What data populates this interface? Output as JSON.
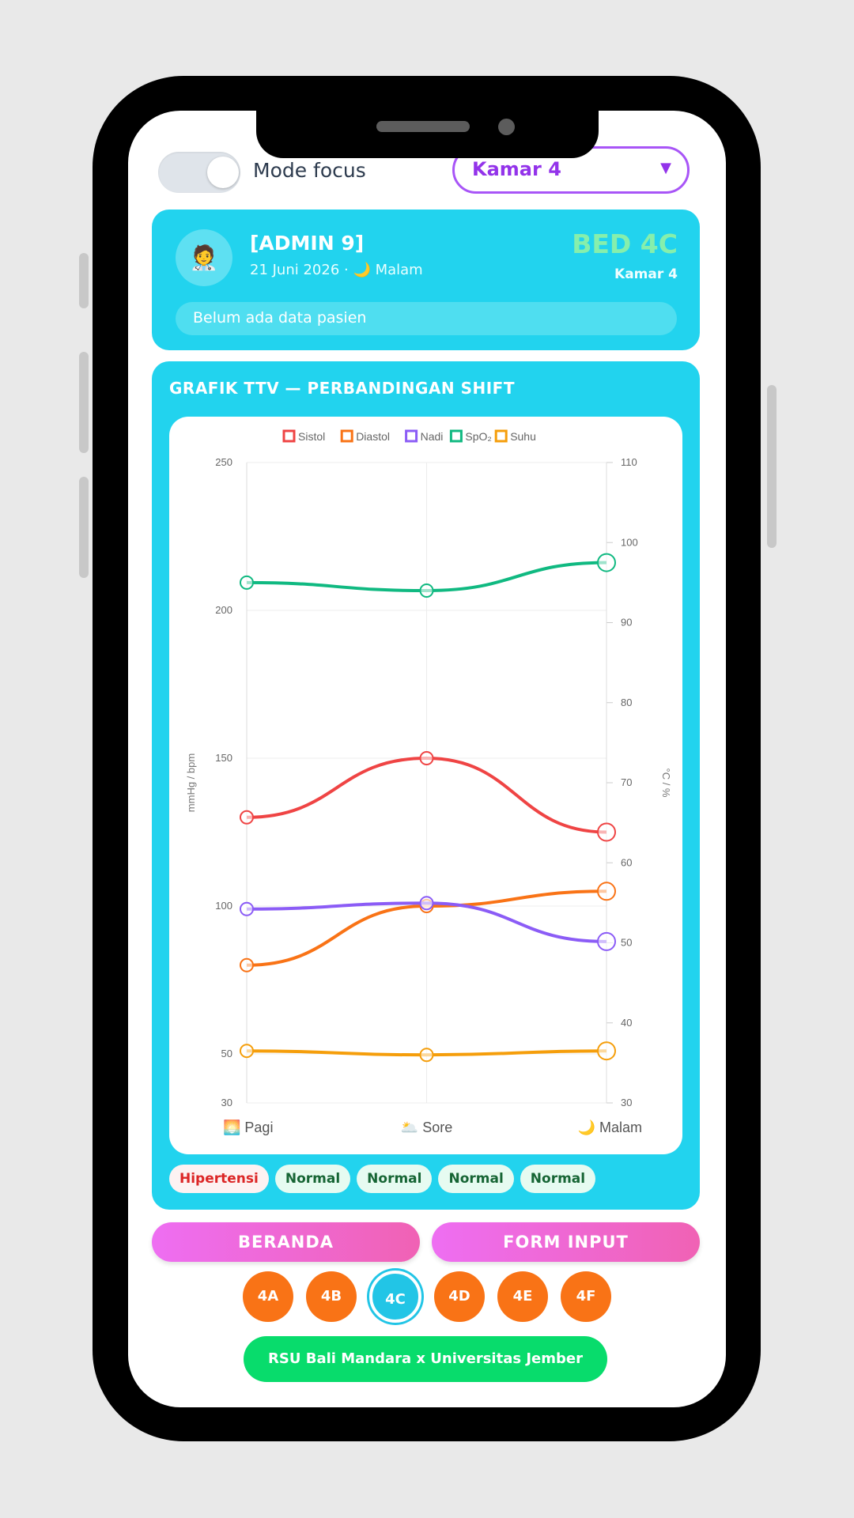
{
  "topbar": {
    "mode_label": "Mode focus",
    "mode_enabled": true,
    "room_select_value": "Kamar 4"
  },
  "patient_card": {
    "avatar_emoji": "🧑‍⚕️",
    "name": "[ADMIN 9]",
    "date_shift": "21 Juni 2026 · 🌙 Malam",
    "bed_title": "BED 4C",
    "room": "Kamar 4",
    "empty_text": "Belum ada data pasien"
  },
  "chart_section": {
    "title": "GRAFIK TTV — PERBANDINGAN SHIFT"
  },
  "chart_data": {
    "type": "line",
    "x": [
      "🌅 Pagi",
      "🌥️ Sore",
      "🌙 Malam"
    ],
    "series": [
      {
        "name": "Sistol",
        "axis": "left",
        "color": "#ef4444",
        "values": [
          130,
          150,
          125
        ]
      },
      {
        "name": "Diastol",
        "axis": "left",
        "color": "#f97316",
        "values": [
          80,
          100,
          105
        ]
      },
      {
        "name": "Nadi",
        "axis": "left",
        "color": "#8b5cf6",
        "values": [
          99,
          101,
          88
        ]
      },
      {
        "name": "SpO₂",
        "axis": "right",
        "color": "#10b981",
        "values": [
          95,
          94,
          97.5
        ]
      },
      {
        "name": "Suhu",
        "axis": "right",
        "color": "#f59e0b",
        "values": [
          36.5,
          36,
          36.5
        ]
      }
    ],
    "left_axis": {
      "label": "mmHg / bpm",
      "ticks": [
        30,
        50,
        100,
        150,
        200,
        250
      ],
      "range": [
        30,
        250
      ]
    },
    "right_axis": {
      "label": "°C / %",
      "ticks": [
        30,
        40,
        50,
        60,
        70,
        80,
        90,
        100,
        110
      ],
      "range": [
        30,
        110
      ]
    },
    "legend_position": "top",
    "grid": true
  },
  "status_badges": [
    {
      "label": "Hipertensi",
      "type": "alert"
    },
    {
      "label": "Normal",
      "type": "normal"
    },
    {
      "label": "Normal",
      "type": "normal"
    },
    {
      "label": "Normal",
      "type": "normal"
    },
    {
      "label": "Normal",
      "type": "normal"
    }
  ],
  "actions": {
    "home_label": "BERANDA",
    "form_label": "FORM INPUT"
  },
  "bed_nav": {
    "items": [
      "4A",
      "4B",
      "4C",
      "4D",
      "4E",
      "4F"
    ],
    "active": "4C"
  },
  "footer": {
    "label": "RSU Bali Mandara x Universitas Jember"
  }
}
